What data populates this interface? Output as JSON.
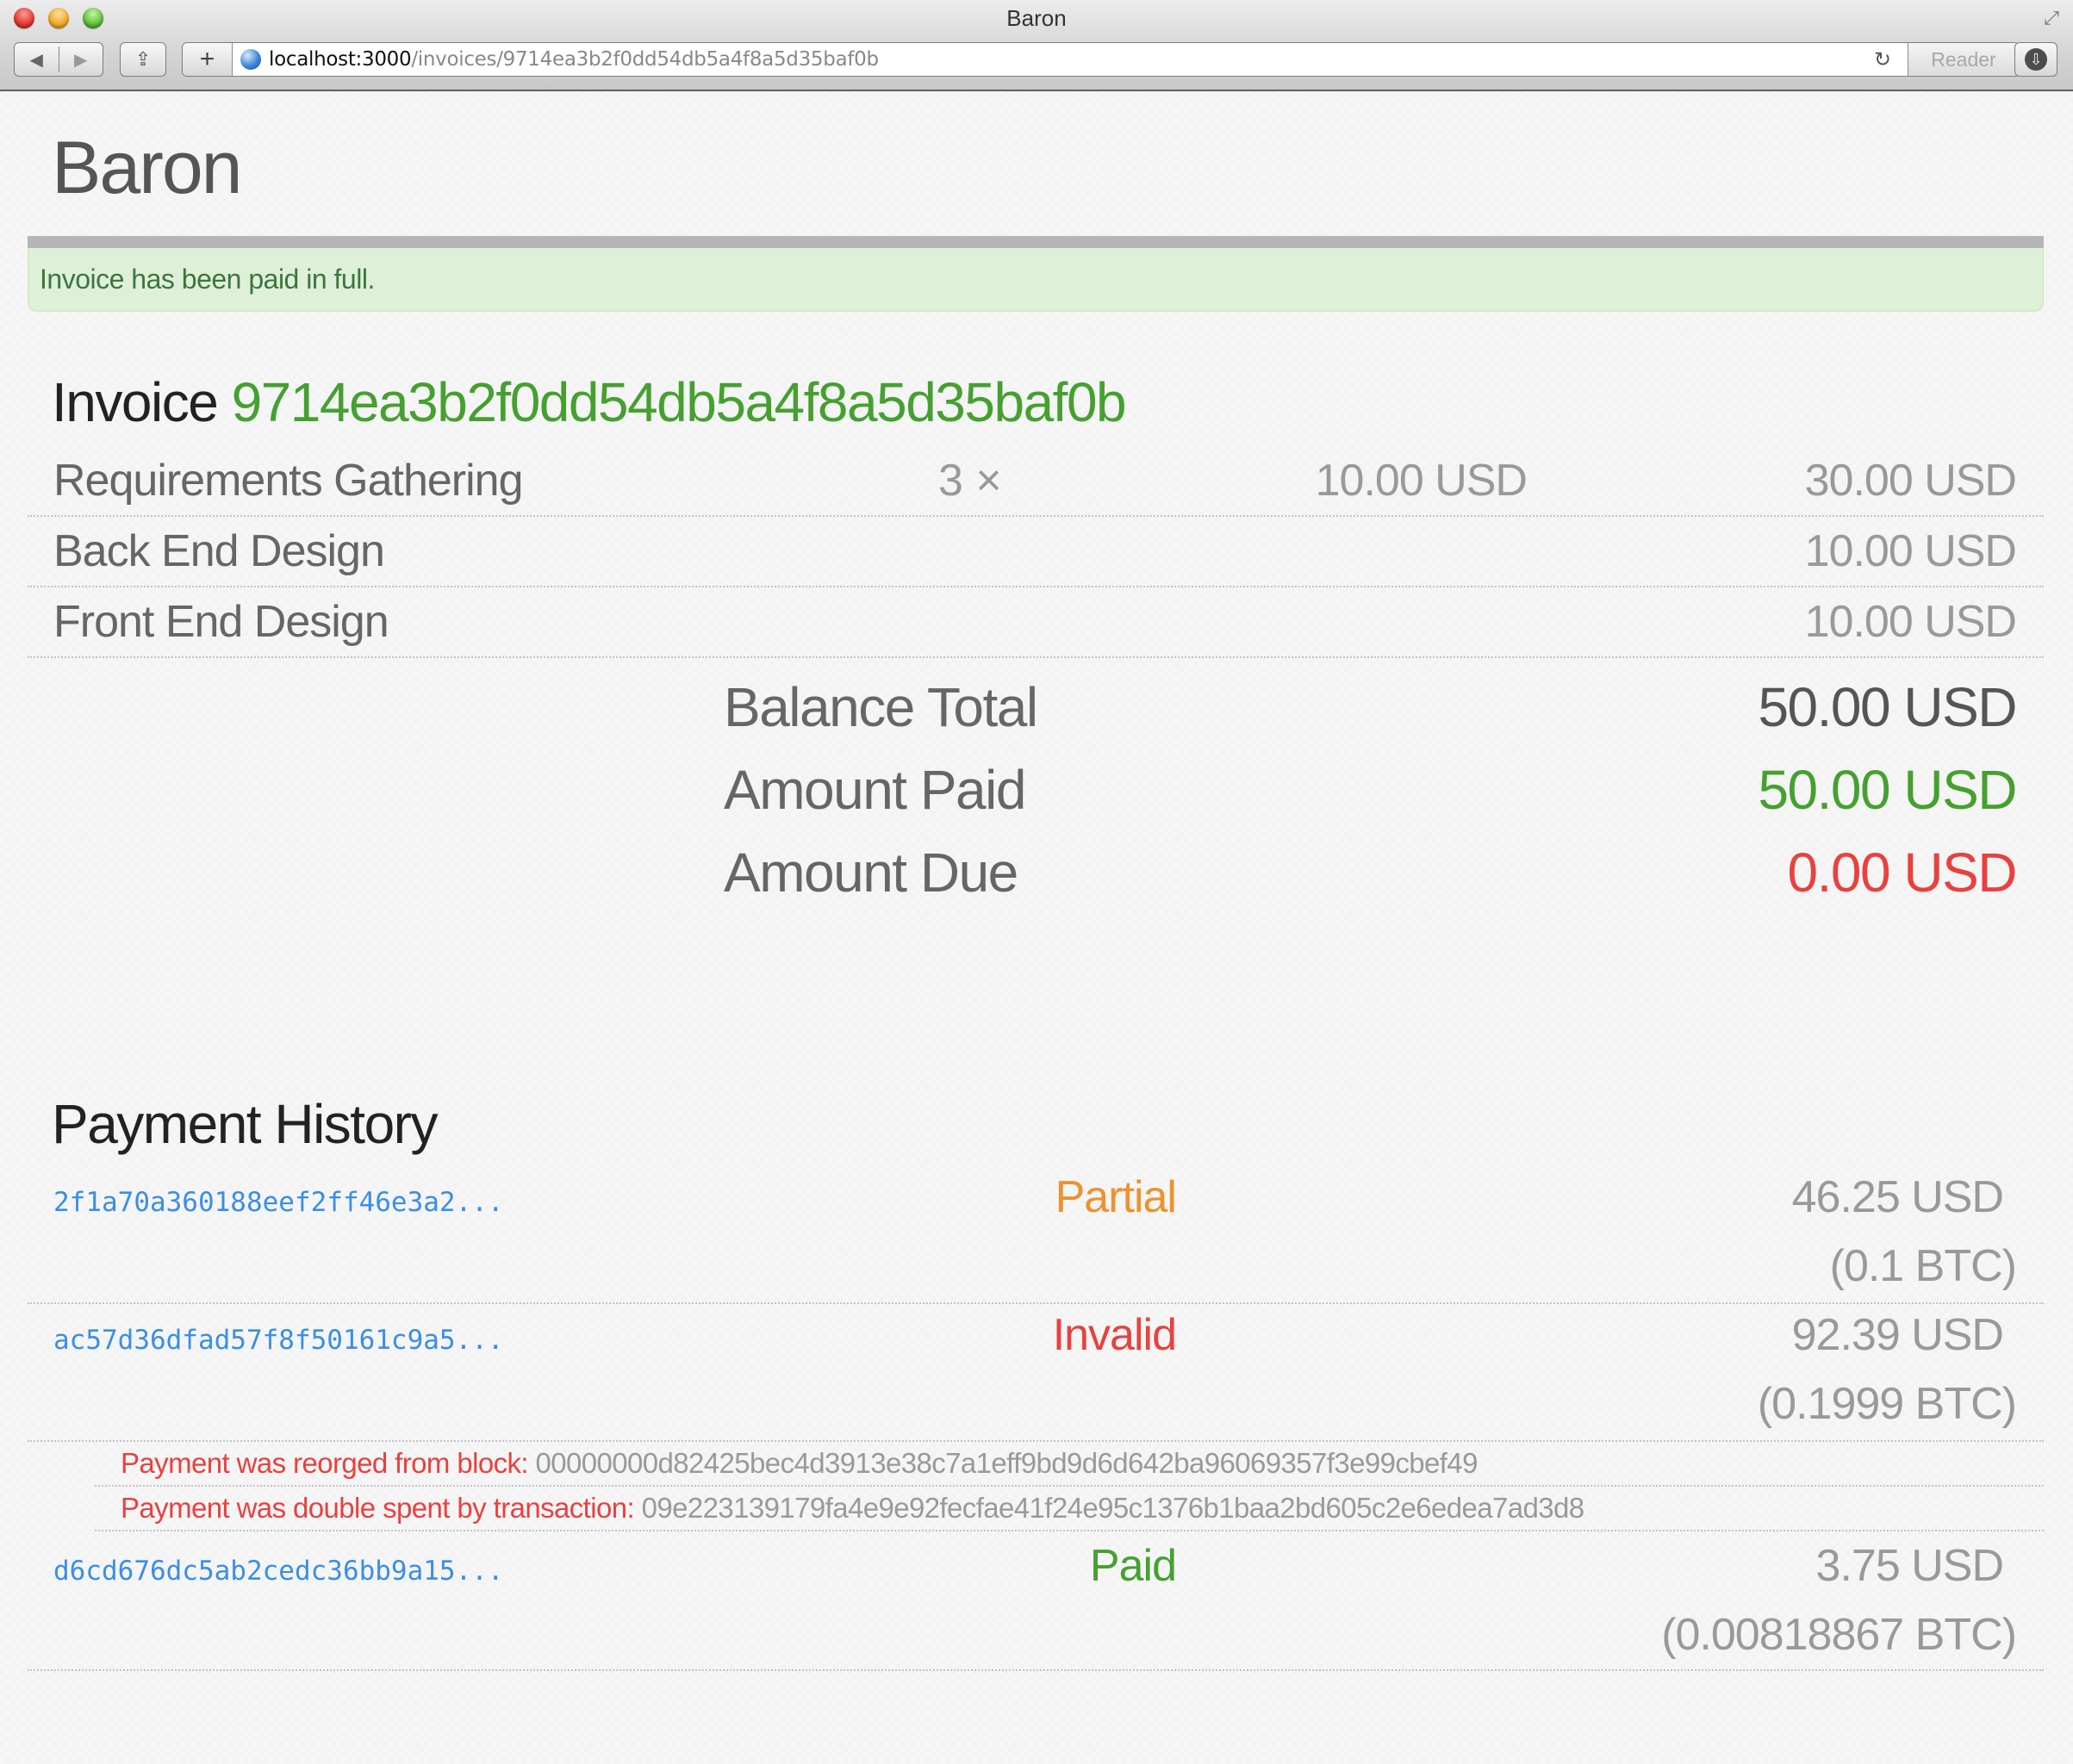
{
  "browser": {
    "window_title": "Baron",
    "url_host": "localhost:3000",
    "url_path": "/invoices/9714ea3b2f0dd54db5a4f8a5d35baf0b",
    "reader_label": "Reader",
    "icons": {
      "back": "◀",
      "forward": "▶",
      "share": "⇪",
      "new_tab": "+",
      "reload": "↻",
      "download": "⇩",
      "fullscreen": "⤢"
    }
  },
  "header": {
    "brand": "Baron"
  },
  "alert": {
    "message": "Invoice has been paid in full."
  },
  "invoice": {
    "title_prefix": "Invoice",
    "id": "9714ea3b2f0dd54db5a4f8a5d35baf0b",
    "line_items": [
      {
        "name": "Requirements Gathering",
        "quantity": "3 ×",
        "unit_price": "10.00 USD",
        "total": "30.00 USD"
      },
      {
        "name": "Back End Design",
        "quantity": "",
        "unit_price": "",
        "total": "10.00 USD"
      },
      {
        "name": "Front End Design",
        "quantity": "",
        "unit_price": "",
        "total": "10.00 USD"
      }
    ],
    "totals": {
      "balance_total_label": "Balance Total",
      "balance_total_value": "50.00 USD",
      "amount_paid_label": "Amount Paid",
      "amount_paid_value": "50.00 USD",
      "amount_due_label": "Amount Due",
      "amount_due_value": "0.00 USD"
    }
  },
  "payment_history": {
    "title": "Payment History",
    "payments": [
      {
        "tx_id": "2f1a70a360188eef2ff46e3a2...",
        "status": "Partial",
        "usd": "46.25 USD",
        "btc": "(0.1 BTC)"
      },
      {
        "tx_id": "ac57d36dfad57f8f50161c9a5...",
        "status": "Invalid",
        "usd": "92.39 USD",
        "btc": "(0.1999 BTC)",
        "messages": [
          {
            "label": "Payment was reorged from block:",
            "hash": "00000000d82425bec4d3913e38c7a1eff9bd9d6d642ba96069357f3e99cbef49"
          },
          {
            "label": "Payment was double spent by transaction:",
            "hash": "09e223139179fa4e9e92fecfae41f24e95c1376b1baa2bd605c2e6edea7ad3d8"
          }
        ]
      },
      {
        "tx_id": "d6cd676dc5ab2cedc36bb9a15...",
        "status": "Paid",
        "usd": "3.75 USD",
        "btc": "(0.00818867 BTC)"
      }
    ]
  },
  "colors": {
    "accent_green": "#45a030",
    "paid_green": "#45a030",
    "due_red": "#e8413f",
    "partial_orange": "#ea9330",
    "invalid_red": "#e8413f",
    "link_blue": "#3a8ee6",
    "alert_bg": "#dff0d8",
    "alert_text": "#3c763d"
  }
}
